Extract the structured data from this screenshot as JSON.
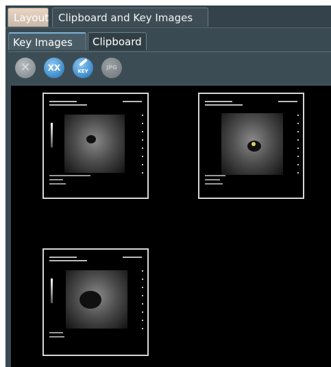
{
  "top_tabs": [
    {
      "label": "Layout",
      "active": false
    },
    {
      "label": "Clipboard and Key Images",
      "active": true
    }
  ],
  "sub_tabs": [
    {
      "label": "Key Images",
      "active": true
    },
    {
      "label": "Clipboard",
      "active": false
    }
  ],
  "toolbar": {
    "buttons": [
      {
        "name": "delete",
        "icon": "close-icon",
        "glyph": "✕",
        "enabled": false
      },
      {
        "name": "delete-all",
        "icon": "delete-all-icon",
        "glyph": "XX",
        "enabled": true
      },
      {
        "name": "key-edit",
        "icon": "key-pencil-icon",
        "glyph": "KEY",
        "enabled": true
      },
      {
        "name": "export-jpg",
        "icon": "jpg-icon",
        "glyph": "JPG",
        "enabled": false
      }
    ]
  },
  "key_images": [
    {
      "id": "thumb-1"
    },
    {
      "id": "thumb-2"
    },
    {
      "id": "thumb-3"
    }
  ],
  "colors": {
    "accent": "#1a6fb7",
    "background": "#000000",
    "panel": "#3a4a53"
  }
}
